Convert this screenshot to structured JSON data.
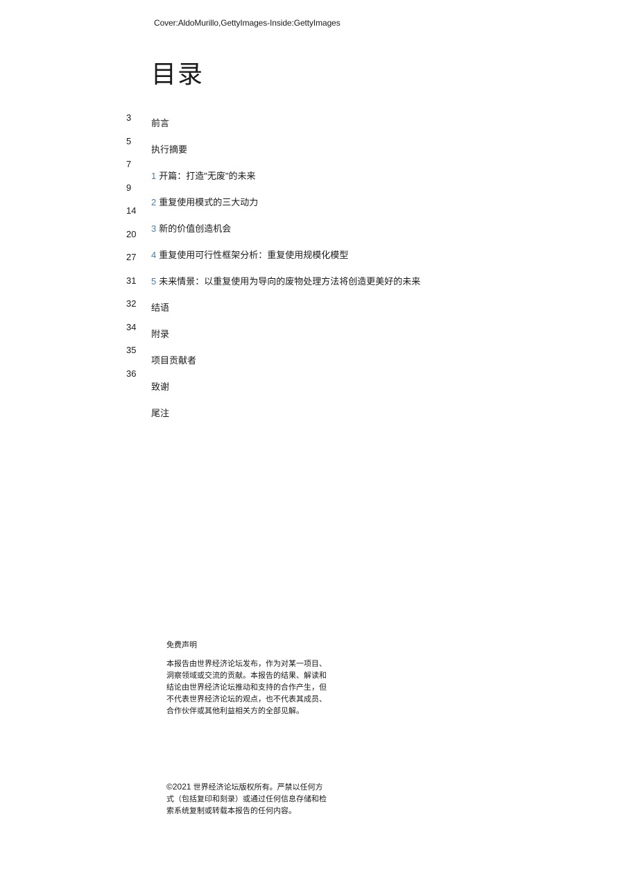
{
  "credits": "Cover:AldoMurillo,GettyImages-Inside:GettyImages",
  "title": "目录",
  "toc": {
    "pages": [
      "3",
      "5",
      "7",
      "9",
      "14",
      "20",
      "27",
      "31",
      "32",
      "34",
      "35",
      "36"
    ],
    "entries": [
      {
        "num": "",
        "label": "前言"
      },
      {
        "num": "",
        "label": "执行摘要"
      },
      {
        "num": "1",
        "label": "开篇：打造\"无废\"的未来"
      },
      {
        "num": "2",
        "label": "重复使用模式的三大动力"
      },
      {
        "num": "3",
        "label": "新的价值创造机会"
      },
      {
        "num": "4",
        "label": "重复使用可行性框架分析：重复使用规模化模型"
      },
      {
        "num": "5",
        "label": "未来情景：以重复使用为导向的废物处理方法将创造更美好的未来"
      },
      {
        "num": "",
        "label": "结语"
      },
      {
        "num": "",
        "label": "附录"
      },
      {
        "num": "",
        "label": "项目贡献者"
      },
      {
        "num": "",
        "label": "致谢"
      },
      {
        "num": "",
        "label": "尾注"
      }
    ]
  },
  "disclaimer": {
    "heading": "免费声明",
    "body": "本报告由世界经济论坛发布，作为对某一项目、洞察领域或交流的贡献。本报告的结果、解读和结论由世界经济论坛推动和支持的合作产生，但不代表世界经济论坛的观点，也不代表其成员、合作伙伴或其他利益相关方的全部见解。"
  },
  "copyright": {
    "prefix": "©2021",
    "body": " 世界经济论坛版权所有。严禁以任何方式（包括复印和刻录）或通过任何信息存储和检索系统复制或转载本报告的任何内容。"
  }
}
